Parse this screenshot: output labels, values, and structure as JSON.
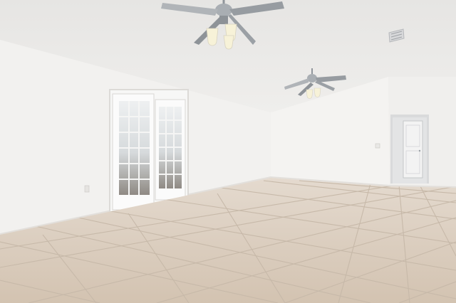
{
  "scene": {
    "kind": "empty-room-photo",
    "wall_color": "#f1f0ee",
    "ceiling_color": "#ecebe9",
    "floor_color": "#dccdbd",
    "grout_color": "#c9bcad",
    "door_glass_color": "#b9bcbe",
    "fixture_color": "#9aa0a6",
    "light_color": "#f7f2d8"
  },
  "objects": [
    {
      "name": "ceiling-fan-icon"
    },
    {
      "name": "french-door-icon"
    },
    {
      "name": "interior-door-icon"
    },
    {
      "name": "air-vent-icon"
    },
    {
      "name": "tile-floor"
    }
  ]
}
